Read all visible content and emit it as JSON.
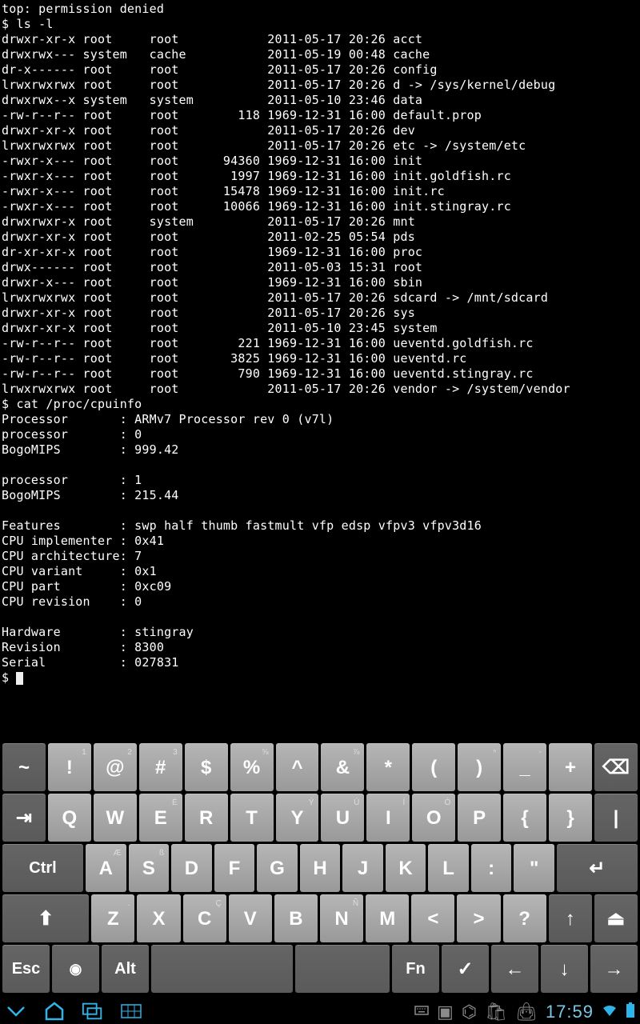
{
  "terminal": {
    "error": "top: permission denied",
    "prompt1": "$ ",
    "cmd1": "ls -l",
    "ls": [
      {
        "perm": "drwxr-xr-x",
        "owner": "root",
        "group": "root",
        "size": "",
        "date": "2011-05-17 20:26",
        "name": "acct"
      },
      {
        "perm": "drwxrwx---",
        "owner": "system",
        "group": "cache",
        "size": "",
        "date": "2011-05-19 00:48",
        "name": "cache"
      },
      {
        "perm": "dr-x------",
        "owner": "root",
        "group": "root",
        "size": "",
        "date": "2011-05-17 20:26",
        "name": "config"
      },
      {
        "perm": "lrwxrwxrwx",
        "owner": "root",
        "group": "root",
        "size": "",
        "date": "2011-05-17 20:26",
        "name": "d -> /sys/kernel/debug"
      },
      {
        "perm": "drwxrwx--x",
        "owner": "system",
        "group": "system",
        "size": "",
        "date": "2011-05-10 23:46",
        "name": "data"
      },
      {
        "perm": "-rw-r--r--",
        "owner": "root",
        "group": "root",
        "size": "118",
        "date": "1969-12-31 16:00",
        "name": "default.prop"
      },
      {
        "perm": "drwxr-xr-x",
        "owner": "root",
        "group": "root",
        "size": "",
        "date": "2011-05-17 20:26",
        "name": "dev"
      },
      {
        "perm": "lrwxrwxrwx",
        "owner": "root",
        "group": "root",
        "size": "",
        "date": "2011-05-17 20:26",
        "name": "etc -> /system/etc"
      },
      {
        "perm": "-rwxr-x---",
        "owner": "root",
        "group": "root",
        "size": "94360",
        "date": "1969-12-31 16:00",
        "name": "init"
      },
      {
        "perm": "-rwxr-x---",
        "owner": "root",
        "group": "root",
        "size": "1997",
        "date": "1969-12-31 16:00",
        "name": "init.goldfish.rc"
      },
      {
        "perm": "-rwxr-x---",
        "owner": "root",
        "group": "root",
        "size": "15478",
        "date": "1969-12-31 16:00",
        "name": "init.rc"
      },
      {
        "perm": "-rwxr-x---",
        "owner": "root",
        "group": "root",
        "size": "10066",
        "date": "1969-12-31 16:00",
        "name": "init.stingray.rc"
      },
      {
        "perm": "drwxrwxr-x",
        "owner": "root",
        "group": "system",
        "size": "",
        "date": "2011-05-17 20:26",
        "name": "mnt"
      },
      {
        "perm": "drwxr-xr-x",
        "owner": "root",
        "group": "root",
        "size": "",
        "date": "2011-02-25 05:54",
        "name": "pds"
      },
      {
        "perm": "dr-xr-xr-x",
        "owner": "root",
        "group": "root",
        "size": "",
        "date": "1969-12-31 16:00",
        "name": "proc"
      },
      {
        "perm": "drwx------",
        "owner": "root",
        "group": "root",
        "size": "",
        "date": "2011-05-03 15:31",
        "name": "root"
      },
      {
        "perm": "drwxr-x---",
        "owner": "root",
        "group": "root",
        "size": "",
        "date": "1969-12-31 16:00",
        "name": "sbin"
      },
      {
        "perm": "lrwxrwxrwx",
        "owner": "root",
        "group": "root",
        "size": "",
        "date": "2011-05-17 20:26",
        "name": "sdcard -> /mnt/sdcard"
      },
      {
        "perm": "drwxr-xr-x",
        "owner": "root",
        "group": "root",
        "size": "",
        "date": "2011-05-17 20:26",
        "name": "sys"
      },
      {
        "perm": "drwxr-xr-x",
        "owner": "root",
        "group": "root",
        "size": "",
        "date": "2011-05-10 23:45",
        "name": "system"
      },
      {
        "perm": "-rw-r--r--",
        "owner": "root",
        "group": "root",
        "size": "221",
        "date": "1969-12-31 16:00",
        "name": "ueventd.goldfish.rc"
      },
      {
        "perm": "-rw-r--r--",
        "owner": "root",
        "group": "root",
        "size": "3825",
        "date": "1969-12-31 16:00",
        "name": "ueventd.rc"
      },
      {
        "perm": "-rw-r--r--",
        "owner": "root",
        "group": "root",
        "size": "790",
        "date": "1969-12-31 16:00",
        "name": "ueventd.stingray.rc"
      },
      {
        "perm": "lrwxrwxrwx",
        "owner": "root",
        "group": "root",
        "size": "",
        "date": "2011-05-17 20:26",
        "name": "vendor -> /system/vendor"
      }
    ],
    "cmd2": "cat /proc/cpuinfo",
    "cpuinfo": [
      [
        "Processor",
        ": ARMv7 Processor rev 0 (v7l)"
      ],
      [
        "processor",
        ": 0"
      ],
      [
        "BogoMIPS",
        ": 999.42"
      ],
      [
        "",
        ""
      ],
      [
        "processor",
        ": 1"
      ],
      [
        "BogoMIPS",
        ": 215.44"
      ],
      [
        "",
        ""
      ],
      [
        "Features",
        ": swp half thumb fastmult vfp edsp vfpv3 vfpv3d16"
      ],
      [
        "CPU implementer",
        ": 0x41"
      ],
      [
        "CPU architecture",
        ": 7"
      ],
      [
        "CPU variant",
        ": 0x1"
      ],
      [
        "CPU part",
        ": 0xc09"
      ],
      [
        "CPU revision",
        ": 0"
      ],
      [
        "",
        ""
      ],
      [
        "Hardware",
        ": stingray"
      ],
      [
        "Revision",
        ": 8300"
      ],
      [
        "Serial",
        ": 027831"
      ]
    ],
    "prompt3": "$ "
  },
  "keyboard": {
    "rows": [
      [
        {
          "label": "~",
          "cls": ""
        },
        {
          "label": "!",
          "sup": "1",
          "cls": "light"
        },
        {
          "label": "@",
          "sup": "2",
          "cls": "light"
        },
        {
          "label": "#",
          "sup": "3",
          "cls": "light"
        },
        {
          "label": "$",
          "sup": "",
          "cls": "light"
        },
        {
          "label": "%",
          "sup": "⅝",
          "cls": "light"
        },
        {
          "label": "^",
          "sup": "",
          "cls": "light"
        },
        {
          "label": "&",
          "sup": "⅞",
          "cls": "light"
        },
        {
          "label": "*",
          "sup": "",
          "cls": "light"
        },
        {
          "label": "(",
          "sup": "",
          "cls": "light"
        },
        {
          "label": ")",
          "sup": "ⁿ",
          "cls": "light"
        },
        {
          "label": "_",
          "sup": "-",
          "cls": "light"
        },
        {
          "label": "+",
          "sup": "",
          "cls": "light"
        },
        {
          "label": "⌫",
          "sup": "",
          "cls": ""
        }
      ],
      [
        {
          "label": "⇥",
          "cls": ""
        },
        {
          "label": "Q",
          "cls": "light"
        },
        {
          "label": "W",
          "cls": "light"
        },
        {
          "label": "E",
          "sup": "É",
          "cls": "light"
        },
        {
          "label": "R",
          "cls": "light"
        },
        {
          "label": "T",
          "cls": "light"
        },
        {
          "label": "Y",
          "sup": "Ý",
          "cls": "light"
        },
        {
          "label": "U",
          "sup": "Ú",
          "cls": "light"
        },
        {
          "label": "I",
          "sup": "Í",
          "cls": "light"
        },
        {
          "label": "O",
          "sup": "Ó",
          "cls": "light"
        },
        {
          "label": "P",
          "sup": "",
          "cls": "light"
        },
        {
          "label": "{",
          "cls": "light"
        },
        {
          "label": "}",
          "cls": "light"
        },
        {
          "label": "|",
          "cls": ""
        }
      ],
      [
        {
          "label": "Ctrl",
          "cls": "wide2",
          "font": "20"
        },
        {
          "label": "A",
          "sup": "Æ",
          "cls": "light"
        },
        {
          "label": "S",
          "sup": "ß",
          "cls": "light"
        },
        {
          "label": "D",
          "cls": "light"
        },
        {
          "label": "F",
          "cls": "light"
        },
        {
          "label": "G",
          "cls": "light"
        },
        {
          "label": "H",
          "cls": "light"
        },
        {
          "label": "J",
          "cls": "light"
        },
        {
          "label": "K",
          "cls": "light"
        },
        {
          "label": "L",
          "cls": "light"
        },
        {
          "label": ":",
          "cls": "light"
        },
        {
          "label": "\"",
          "cls": "light"
        },
        {
          "label": "↵",
          "cls": "wide2"
        }
      ],
      [
        {
          "label": "⬆",
          "cls": "wide2"
        },
        {
          "label": "Z",
          "sup": ".",
          "cls": "light"
        },
        {
          "label": "X",
          "cls": "light"
        },
        {
          "label": "C",
          "sup": "Ç",
          "cls": "light"
        },
        {
          "label": "V",
          "cls": "light"
        },
        {
          "label": "B",
          "cls": "light"
        },
        {
          "label": "N",
          "sup": "Ñ",
          "cls": "light"
        },
        {
          "label": "M",
          "cls": "light"
        },
        {
          "label": "<",
          "cls": "light"
        },
        {
          "label": ">",
          "cls": "light"
        },
        {
          "label": "?",
          "cls": "light"
        },
        {
          "label": "↑",
          "cls": ""
        },
        {
          "label": "⏏",
          "cls": ""
        }
      ],
      [
        {
          "label": "Esc",
          "cls": "",
          "font": "20"
        },
        {
          "label": "◉",
          "cls": "",
          "font": "18"
        },
        {
          "label": "Alt",
          "cls": "",
          "font": "20"
        },
        {
          "label": " ",
          "cls": "wide3"
        },
        {
          "label": " ",
          "cls": "wide2"
        },
        {
          "label": "Fn",
          "cls": "",
          "font": "20"
        },
        {
          "label": "✓",
          "cls": ""
        },
        {
          "label": "←",
          "cls": ""
        },
        {
          "label": "↓",
          "cls": ""
        },
        {
          "label": "→",
          "cls": ""
        }
      ]
    ]
  },
  "status": {
    "time": "17:59"
  }
}
